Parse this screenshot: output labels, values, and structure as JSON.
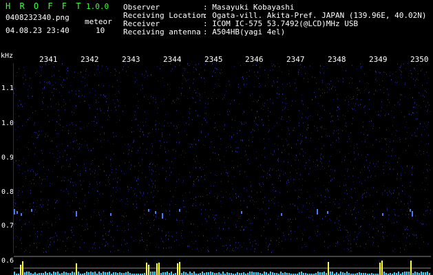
{
  "header": {
    "app_name": "H R O F F T",
    "version": "1.0.0",
    "filename": "0408232340.png",
    "meteor_label": "meteor",
    "meteor_count": "10",
    "datetime": "04.08.23 23:40",
    "info": [
      {
        "label": "Observer",
        "value": ": Masayuki Kobayashi"
      },
      {
        "label": "Receiving Location",
        "value": ": Ogata-vill. Akita-Pref. JAPAN (139.96E, 40.02N)"
      },
      {
        "label": "Receiver",
        "value": ": ICOM IC-575 53.7492(@LCD)MHz USB"
      },
      {
        "label": "Receiving antenna",
        "value": ": A504HB(yagi 4el)"
      }
    ]
  },
  "axis": {
    "unit": "kHz",
    "time_ticks": [
      "2341",
      "2342",
      "2343",
      "2344",
      "2345",
      "2346",
      "2347",
      "2348",
      "2349",
      "2350"
    ],
    "freq_ticks": [
      "1.1",
      "1.0",
      "0.9",
      "0.8",
      "0.7",
      "0.6"
    ]
  },
  "colors": {
    "background": "#000000",
    "title": "#3cff3c",
    "noise": "#1a1a6e",
    "echo": "#4a78ff",
    "strip": "#33d6ff",
    "strip_peak": "#ffff33"
  }
}
